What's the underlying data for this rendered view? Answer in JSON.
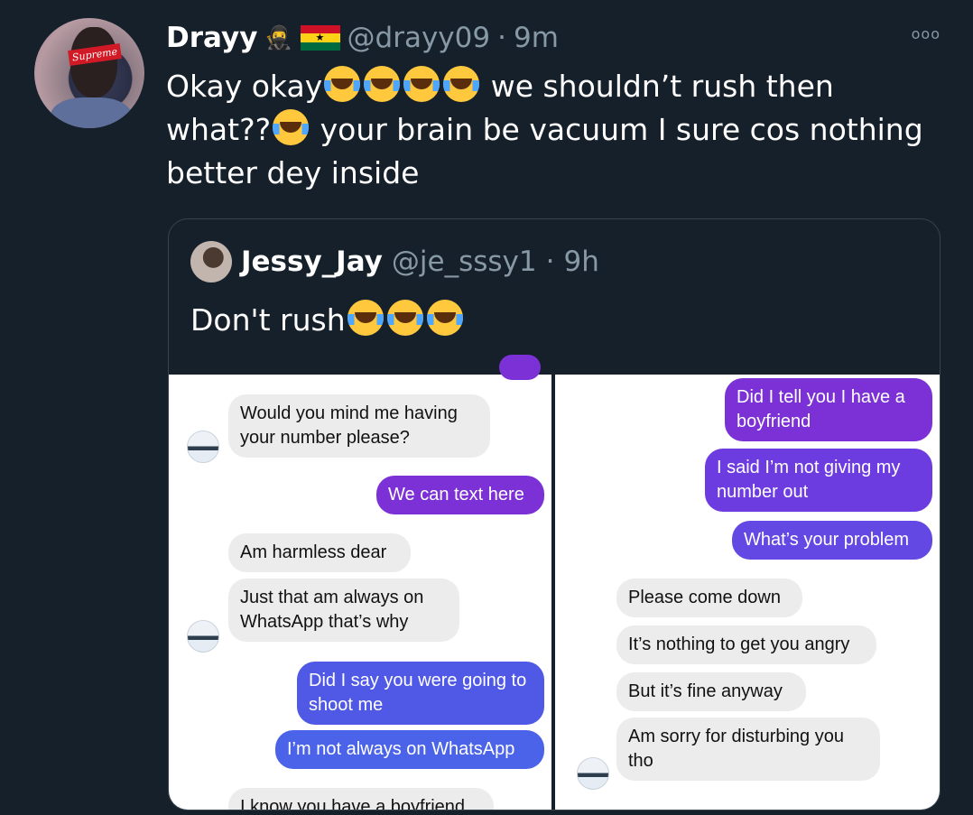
{
  "tweet": {
    "display_name": "Drayy",
    "name_emoji": "🥷",
    "handle": "@drayy09",
    "separator": "·",
    "time": "9m",
    "more_icon": "ooo",
    "text_parts": [
      "Okay okay",
      "😂😂😂😂",
      " we shouldn’t rush then what??",
      "😂",
      " your brain be vacuum I sure cos nothing better dey inside"
    ],
    "avatar_text": "Supreme"
  },
  "quoted": {
    "display_name": "Jessy_Jay",
    "handle": "@je_sssy1",
    "separator": "·",
    "time": "9h",
    "text_parts": [
      "Don't rush",
      "😂😂😂"
    ]
  },
  "chat_left": [
    {
      "side": "in",
      "text": "Would you mind me having your number please?"
    },
    {
      "side": "out",
      "text": "We can text here"
    },
    {
      "side": "in",
      "text": "Am harmless dear"
    },
    {
      "side": "in",
      "text": "Just that am always on WhatsApp that’s why"
    },
    {
      "side": "out",
      "text": "Did I say you were going to shoot me"
    },
    {
      "side": "out",
      "text": "I’m not always on WhatsApp"
    },
    {
      "side": "in",
      "text": "I know you have a boyfriend"
    }
  ],
  "chat_right": [
    {
      "side": "out",
      "text": "Did I tell you I have a boyfriend"
    },
    {
      "side": "out",
      "text": "I said I’m not giving my number out"
    },
    {
      "side": "out",
      "text": "What’s your problem"
    },
    {
      "side": "in",
      "text": "Please come down"
    },
    {
      "side": "in",
      "text": "It’s nothing to get you angry"
    },
    {
      "side": "in",
      "text": "But it’s fine anyway"
    },
    {
      "side": "in",
      "text": "Am sorry for disturbing you tho"
    }
  ],
  "colors": {
    "background": "#15202b",
    "muted": "#8899a6",
    "incoming": "#ececec",
    "outgoing_purple": "#7b31d6",
    "outgoing_blue": "#4b63e8"
  }
}
